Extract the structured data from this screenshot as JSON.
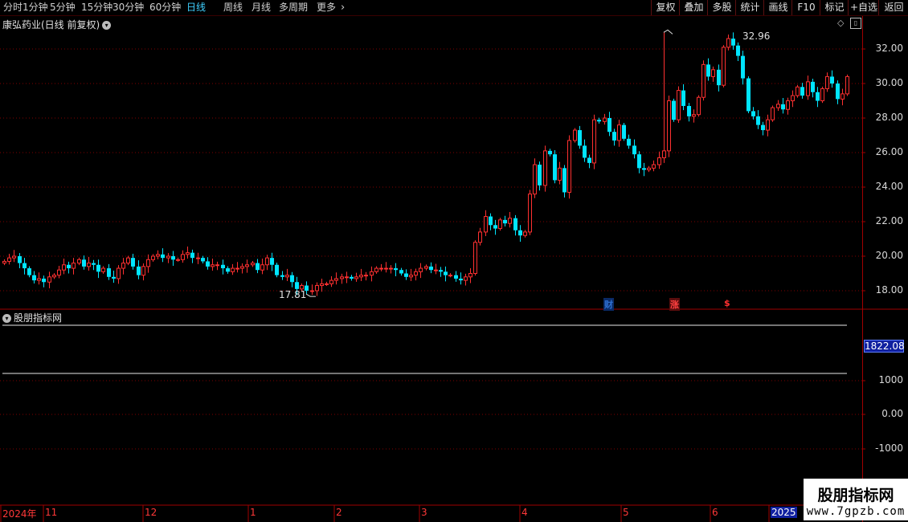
{
  "toolbar": {
    "periods": [
      "分时",
      "1分钟",
      "5分钟",
      "15分钟",
      "30分钟",
      "60分钟",
      "日线",
      "周线",
      "月线",
      "多周期",
      "更多"
    ],
    "active_period": "日线",
    "more_arrow": "›",
    "right_buttons": [
      "复权",
      "叠加",
      "多股",
      "统计",
      "画线",
      "F10",
      "标记",
      "+自选",
      "返回"
    ]
  },
  "chart": {
    "title": "康弘药业(日线 前复权)",
    "high_label": "32.96",
    "low_label": "17.81",
    "event_markers": [
      {
        "text": "财",
        "color": "#2f6fd0",
        "bg": "#0a2a66"
      },
      {
        "text": "涨",
        "color": "#ff4040",
        "bg": "#5a0d0d"
      },
      {
        "text": "$",
        "color": "#ff3030",
        "bg": "#000000"
      }
    ],
    "x_axis_labels": [
      "2024年",
      "11",
      "12",
      "1",
      "2",
      "3",
      "4",
      "5",
      "6",
      "2025"
    ],
    "indicator_title": "股朋指标网",
    "indicator_value": "1822.08"
  },
  "watermark": {
    "line1": "股朋指标网",
    "line2": "www.7gpzb.com"
  },
  "colors": {
    "up": "#ff3030",
    "down": "#00e5ff",
    "grid": "#800000",
    "axis": "#a00000",
    "background": "#000000"
  },
  "chart_data": [
    {
      "type": "candlestick",
      "title": "康弘药业(日线 前复权)",
      "ylabel": "",
      "y_ticks": [
        18.0,
        20.0,
        22.0,
        24.0,
        26.0,
        28.0,
        30.0,
        32.0
      ],
      "ylim": [
        17.0,
        33.5
      ],
      "x_months": [
        "2024年",
        "11",
        "12",
        "1",
        "2",
        "3",
        "4",
        "5",
        "6",
        "2025"
      ],
      "high": 32.96,
      "low": 17.81,
      "closes": [
        19.7,
        19.9,
        20.0,
        19.6,
        19.3,
        18.9,
        18.6,
        18.7,
        18.5,
        18.8,
        18.9,
        19.2,
        19.5,
        19.3,
        19.6,
        19.8,
        19.4,
        19.6,
        19.5,
        19.1,
        19.3,
        18.8,
        18.7,
        19.3,
        19.6,
        19.9,
        19.4,
        18.9,
        19.4,
        19.8,
        20.0,
        20.1,
        19.9,
        20.0,
        19.8,
        19.8,
        20.1,
        20.2,
        19.9,
        19.9,
        19.7,
        19.4,
        19.5,
        19.5,
        19.3,
        19.1,
        19.3,
        19.3,
        19.4,
        19.5,
        19.6,
        19.2,
        19.5,
        19.9,
        19.5,
        18.9,
        18.8,
        18.9,
        18.5,
        18.1,
        18.3,
        18.0,
        18.0,
        18.3,
        18.4,
        18.4,
        18.6,
        18.7,
        18.8,
        18.8,
        18.7,
        18.8,
        18.9,
        18.9,
        19.1,
        19.3,
        19.3,
        19.3,
        19.3,
        19.2,
        19.0,
        18.8,
        18.9,
        19.1,
        19.3,
        19.4,
        19.2,
        19.2,
        19.1,
        18.9,
        18.9,
        18.7,
        18.6,
        18.8,
        19.0,
        20.8,
        21.4,
        22.3,
        21.8,
        21.6,
        22.1,
        21.9,
        22.2,
        21.5,
        21.2,
        21.4,
        23.6,
        25.3,
        24.1,
        26.1,
        25.9,
        24.4,
        25.1,
        23.7,
        26.7,
        27.3,
        26.4,
        25.7,
        25.4,
        27.9,
        27.8,
        28.0,
        27.2,
        26.7,
        27.6,
        26.8,
        26.4,
        25.9,
        25.1,
        25.0,
        25.1,
        25.3,
        25.7,
        26.1,
        29.0,
        27.9,
        29.6,
        28.7,
        28.1,
        28.2,
        29.2,
        31.1,
        30.4,
        30.8,
        29.9,
        32.1,
        32.6,
        32.2,
        31.6,
        30.3,
        28.4,
        28.1,
        27.6,
        27.3,
        27.9,
        28.6,
        28.8,
        28.5,
        29.0,
        29.3,
        29.8,
        29.3,
        30.1,
        29.5,
        29.0,
        29.7,
        30.4,
        30.0,
        29.1,
        29.4,
        30.4
      ]
    },
    {
      "type": "line",
      "title": "股朋指标网",
      "y_ticks": [
        1000,
        0.0,
        -1000
      ],
      "current_value": 1822.08
    }
  ]
}
